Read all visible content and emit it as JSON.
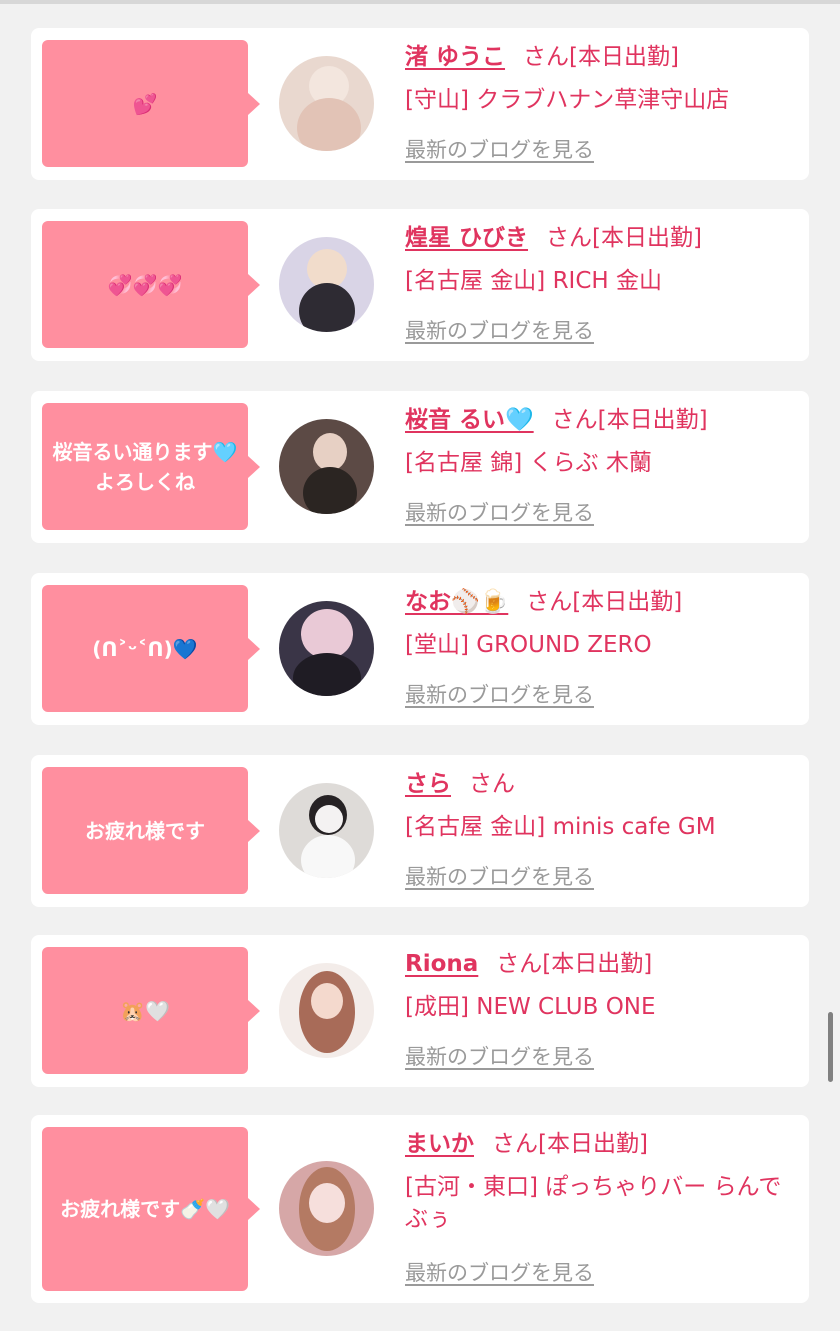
{
  "entries": [
    {
      "message": "💕",
      "name": "渚 ゆうこ",
      "san": "さん",
      "status": "[本日出勤]",
      "shop": "[守山] クラブハナン草津守山店",
      "blog_link": "最新のブログを見る",
      "avatar_color": "#e9d8cf"
    },
    {
      "message": "💞💞💞",
      "name": "煌星 ひびき",
      "san": "さん",
      "status": "[本日出勤]",
      "shop": "[名古屋 金山] RICH 金山",
      "blog_link": "最新のブログを見る",
      "avatar_color": "#d9d4e6"
    },
    {
      "message": "桜音るい通ります🩵よろしくね",
      "name": "桜音 るい🩵",
      "san": "さん",
      "status": "[本日出勤]",
      "shop": "[名古屋 錦] くらぶ 木蘭",
      "blog_link": "最新のブログを見る",
      "avatar_color": "#5c4a45"
    },
    {
      "message": "(ᑎ˃ᵕ˂ᑎ)💙",
      "name": "なお⚾🍺",
      "san": "さん",
      "status": "[本日出勤]",
      "shop": "[堂山] GROUND ZERO",
      "blog_link": "最新のブログを見る",
      "avatar_color": "#3a3547"
    },
    {
      "message": "お疲れ様です",
      "name": "さら",
      "san": "さん",
      "status": "",
      "shop": "[名古屋 金山] minis cafe GM",
      "blog_link": "最新のブログを見る",
      "avatar_color": "#dedbd8"
    },
    {
      "message": "🐹🤍",
      "name": "Riona",
      "san": "さん",
      "status": "[本日出勤]",
      "shop": "[成田] NEW CLUB ONE",
      "blog_link": "最新のブログを見る",
      "avatar_color": "#c99782"
    },
    {
      "message": "お疲れ様です🍼🤍",
      "name": "まいか",
      "san": "さん",
      "status": "[本日出勤]",
      "shop": "[古河・東口] ぽっちゃりバー らんでぶぅ",
      "blog_link": "最新のブログを見る",
      "avatar_color": "#d6a7a7"
    }
  ],
  "colors": {
    "accent": "#e0345f",
    "bubble": "#ff8f9f",
    "muted": "#9a9a9a",
    "background": "#f1f1f1"
  }
}
